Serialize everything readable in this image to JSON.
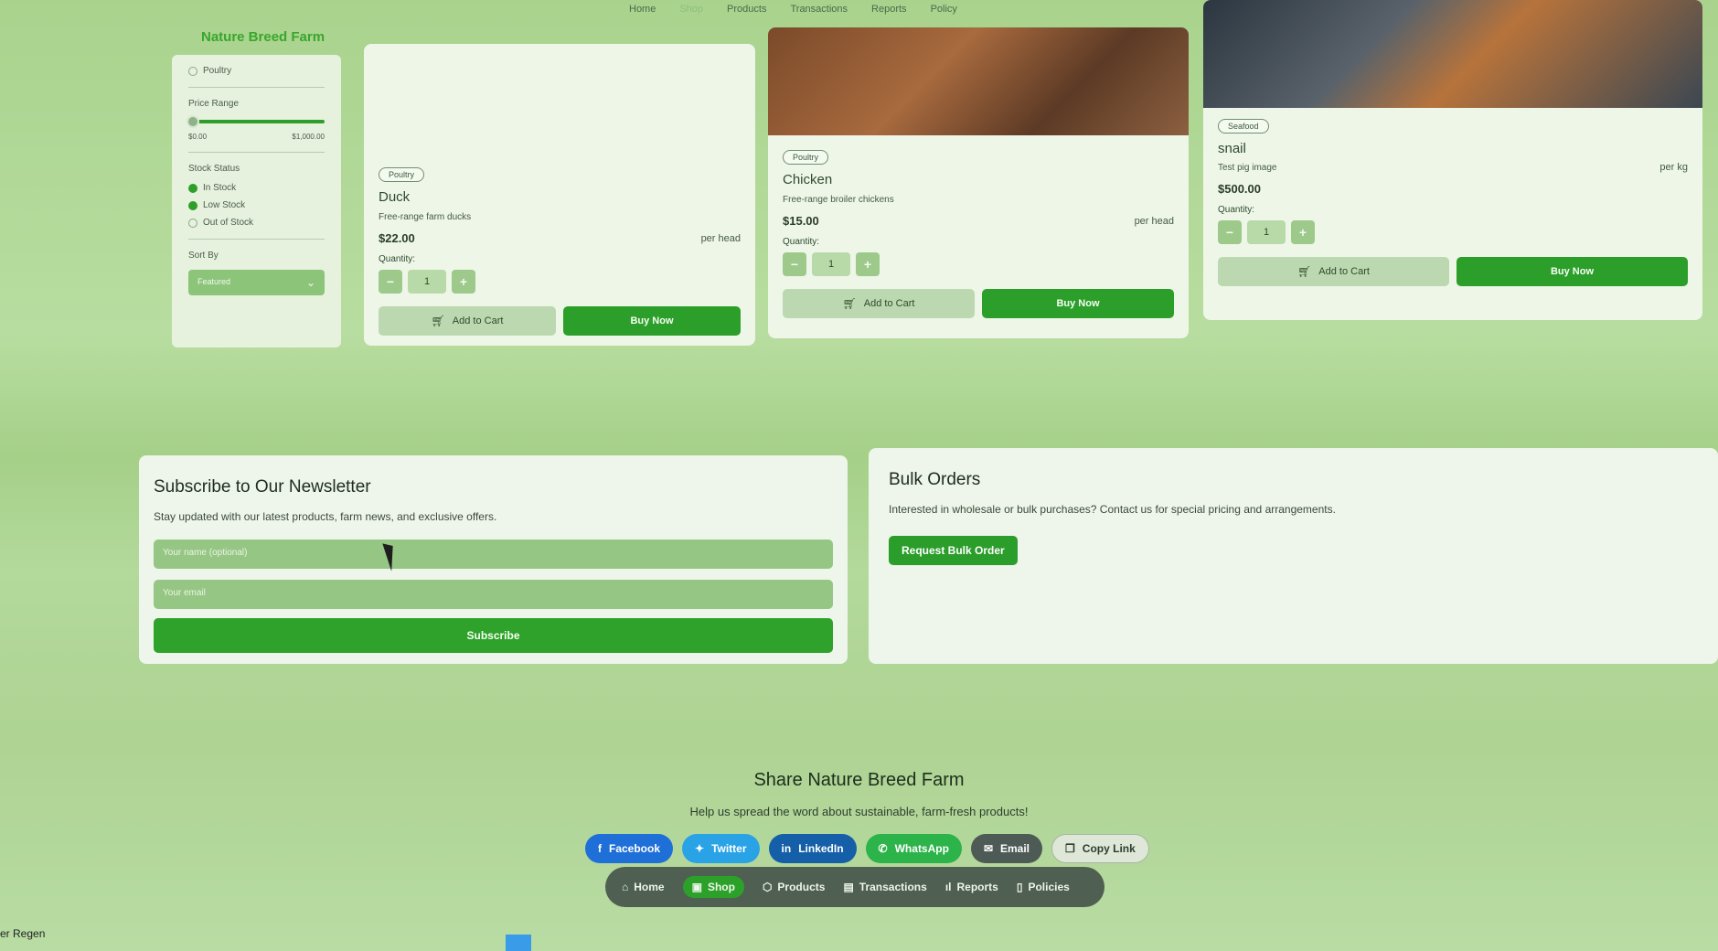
{
  "header": {
    "brand": "Nature Breed Farm",
    "nav": [
      "Home",
      "Shop",
      "Products",
      "Transactions",
      "Reports",
      "Policy"
    ]
  },
  "sidebar": {
    "category_item": "Poultry",
    "price_range_label": "Price Range",
    "price_min": "$0.00",
    "price_max": "$1,000.00",
    "stock_status_label": "Stock Status",
    "stock_options": [
      {
        "label": "In Stock",
        "checked": true
      },
      {
        "label": "Low Stock",
        "checked": true
      },
      {
        "label": "Out of Stock",
        "checked": false
      }
    ],
    "sort_label": "Sort By",
    "sort_value": "Featured"
  },
  "products": [
    {
      "category": "Poultry",
      "name": "Duck",
      "description": "Free-range farm ducks",
      "price": "$22.00",
      "unit": "per head",
      "quantity_label": "Quantity:",
      "quantity": "1",
      "add_to_cart": "Add to Cart",
      "buy_now": "Buy Now"
    },
    {
      "category": "Poultry",
      "name": "Chicken",
      "description": "Free-range broiler chickens",
      "price": "$15.00",
      "unit": "per head",
      "quantity_label": "Quantity:",
      "quantity": "1",
      "add_to_cart": "Add to Cart",
      "buy_now": "Buy Now"
    },
    {
      "category": "Seafood",
      "name": "snail",
      "description": "Test pig image",
      "price": "$500.00",
      "unit": "per kg",
      "quantity_label": "Quantity:",
      "quantity": "1",
      "add_to_cart": "Add to Cart",
      "buy_now": "Buy Now"
    }
  ],
  "newsletter": {
    "title": "Subscribe to Our Newsletter",
    "subtitle": "Stay updated with our latest products, farm news, and exclusive offers.",
    "name_placeholder": "Your name (optional)",
    "email_placeholder": "Your email",
    "subscribe_label": "Subscribe"
  },
  "bulk": {
    "title": "Bulk Orders",
    "text": "Interested in wholesale or bulk purchases? Contact us for special pricing and arrangements.",
    "button": "Request Bulk Order"
  },
  "share": {
    "title": "Share Nature Breed Farm",
    "subtitle": "Help us spread the word about sustainable, farm-fresh products!",
    "buttons": [
      "Facebook",
      "Twitter",
      "LinkedIn",
      "WhatsApp",
      "Email",
      "Copy Link"
    ]
  },
  "bottom_nav": [
    "Home",
    "Shop",
    "Products",
    "Transactions",
    "Reports",
    "Policies"
  ],
  "taskbar": {
    "weather_text": "er Regen"
  },
  "colors": {
    "accent": "#2c9e2a",
    "brand": "#3aa62d"
  }
}
